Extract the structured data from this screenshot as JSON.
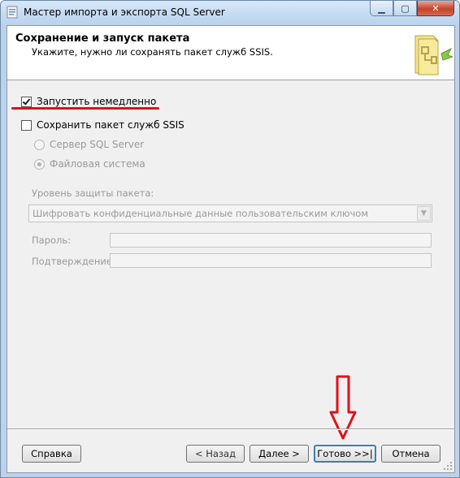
{
  "window": {
    "title": "Мастер импорта и экспорта SQL Server"
  },
  "header": {
    "title": "Сохранение и запуск пакета",
    "subtitle": "Укажите, нужно ли сохранять пакет служб SSIS."
  },
  "options": {
    "run_now": {
      "label": "Запустить немедленно",
      "checked": true
    },
    "save_package": {
      "label": "Сохранить пакет служб SSIS",
      "checked": false
    },
    "radio_sql_server": {
      "label": "Сервер SQL Server",
      "selected": false,
      "enabled": false
    },
    "radio_file_system": {
      "label": "Файловая система",
      "selected": true,
      "enabled": false
    }
  },
  "protection": {
    "label": "Уровень защиты пакета:",
    "selected": "Шифровать конфиденциальные данные пользовательским ключом"
  },
  "password": {
    "label": "Пароль:",
    "value": ""
  },
  "confirm": {
    "label": "Подтверждение:",
    "value": ""
  },
  "buttons": {
    "help": "Справка",
    "back": "< Назад",
    "next": "Далее >",
    "finish": "Готово >>|",
    "cancel": "Отмена"
  },
  "colors": {
    "annotation": "#e0101a",
    "accent": "#3c7fb1"
  }
}
